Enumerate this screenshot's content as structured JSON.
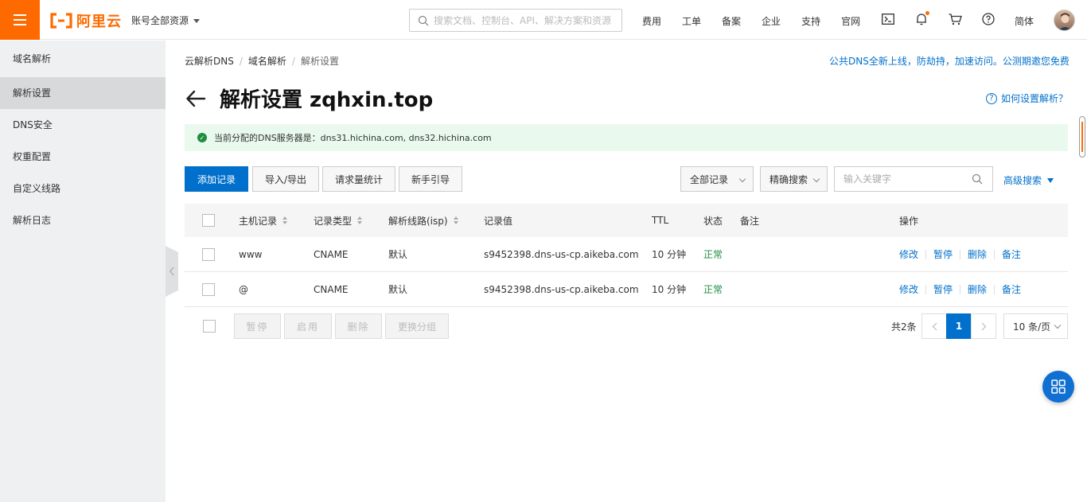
{
  "header": {
    "brand": "阿里云",
    "account_menu": "账号全部资源",
    "search_placeholder": "搜索文档、控制台、API、解决方案和资源",
    "nav": [
      "费用",
      "工单",
      "备案",
      "企业",
      "支持",
      "官网"
    ],
    "language": "简体",
    "icons": [
      "terminal-icon",
      "bell-icon",
      "cart-icon",
      "help-icon"
    ]
  },
  "sidebar": {
    "items": [
      {
        "label": "域名解析"
      },
      {
        "label": "解析设置"
      },
      {
        "label": "DNS安全"
      },
      {
        "label": "权重配置"
      },
      {
        "label": "自定义线路"
      },
      {
        "label": "解析日志"
      }
    ],
    "active_index": 1
  },
  "breadcrumb": [
    "云解析DNS",
    "域名解析",
    "解析设置"
  ],
  "notice": "公共DNS全新上线，防劫持，加速访问。公测期邀您免费",
  "page": {
    "title": "解析设置 zqhxin.top",
    "help_link": "如何设置解析？",
    "alert": "当前分配的DNS服务器是：dns31.hichina.com, dns32.hichina.com"
  },
  "toolbar": {
    "add_record": "添加记录",
    "import_export": "导入/导出",
    "request_stats": "请求量统计",
    "guide": "新手引导",
    "filter_all": "全部记录",
    "search_mode": "精确搜索",
    "keyword_placeholder": "输入关键字",
    "advanced_search": "高级搜索"
  },
  "table": {
    "headers": {
      "host": "主机记录",
      "type": "记录类型",
      "line": "解析线路(isp)",
      "value": "记录值",
      "ttl": "TTL",
      "status": "状态",
      "remark": "备注",
      "actions": "操作"
    },
    "rows": [
      {
        "host": "www",
        "type": "CNAME",
        "line": "默认",
        "value": "s9452398.dns-us-cp.aikeba.com",
        "ttl": "10 分钟",
        "status": "正常"
      },
      {
        "host": "@",
        "type": "CNAME",
        "line": "默认",
        "value": "s9452398.dns-us-cp.aikeba.com",
        "ttl": "10 分钟",
        "status": "正常"
      }
    ],
    "row_actions": {
      "edit": "修改",
      "pause": "暂停",
      "delete": "删除",
      "remark": "备注"
    }
  },
  "bulk": {
    "pause": "暂停",
    "enable": "启用",
    "delete": "删除",
    "change_group": "更换分组"
  },
  "pagination": {
    "total": "共2条",
    "current_page": "1",
    "page_size": "10 条/页"
  },
  "colors": {
    "brand": "#ff6a00",
    "primary": "#0070cc",
    "success": "#1e8e3e"
  }
}
